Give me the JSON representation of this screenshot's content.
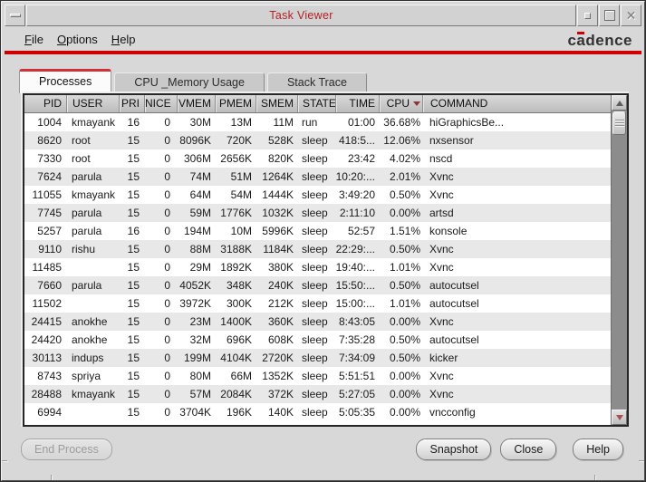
{
  "window": {
    "title": "Task Viewer"
  },
  "icons": {
    "window_menu": "dash",
    "minimize": "small-square",
    "maximize": "square-outline",
    "close": "x-cross",
    "sort_indicator": "triangle-down",
    "scroll_up": "triangle-up",
    "scroll_down": "triangle-down"
  },
  "menubar": {
    "items": [
      "File",
      "Options",
      "Help"
    ],
    "brand": "cadence"
  },
  "tabs": [
    {
      "label": "Processes",
      "active": true
    },
    {
      "label": "CPU _Memory Usage",
      "active": false
    },
    {
      "label": "Stack Trace",
      "active": false
    }
  ],
  "table": {
    "columns": [
      "PID",
      "USER",
      "PRI",
      "NICE",
      "VMEM",
      "PMEM",
      "SMEM",
      "STATE",
      "TIME",
      "CPU",
      "COMMAND"
    ],
    "sort": {
      "column": "CPU",
      "direction": "desc"
    },
    "rows": [
      [
        "1004",
        "kmayank",
        "16",
        "0",
        "30M",
        "13M",
        "11M",
        "run",
        "01:00",
        "36.68%",
        "hiGraphicsBe..."
      ],
      [
        "8620",
        "root",
        "15",
        "0",
        "8096K",
        "720K",
        "528K",
        "sleep",
        "418:5...",
        "12.06%",
        "nxsensor"
      ],
      [
        "7330",
        "root",
        "15",
        "0",
        "306M",
        "2656K",
        "820K",
        "sleep",
        "23:42",
        "4.02%",
        "nscd"
      ],
      [
        "7624",
        "parula",
        "15",
        "0",
        "74M",
        "51M",
        "1264K",
        "sleep",
        "10:20:...",
        "2.01%",
        "Xvnc"
      ],
      [
        "11055",
        "kmayank",
        "15",
        "0",
        "64M",
        "54M",
        "1444K",
        "sleep",
        "3:49:20",
        "0.50%",
        "Xvnc"
      ],
      [
        "7745",
        "parula",
        "15",
        "0",
        "59M",
        "1776K",
        "1032K",
        "sleep",
        "2:11:10",
        "0.00%",
        "artsd"
      ],
      [
        "5257",
        "parula",
        "16",
        "0",
        "194M",
        "10M",
        "5996K",
        "sleep",
        "52:57",
        "1.51%",
        "konsole"
      ],
      [
        "9110",
        "rishu",
        "15",
        "0",
        "88M",
        "3188K",
        "1184K",
        "sleep",
        "22:29:...",
        "0.50%",
        "Xvnc"
      ],
      [
        "11485",
        "",
        "15",
        "0",
        "29M",
        "1892K",
        "380K",
        "sleep",
        "19:40:...",
        "1.01%",
        "Xvnc"
      ],
      [
        "7660",
        "parula",
        "15",
        "0",
        "4052K",
        "348K",
        "240K",
        "sleep",
        "15:50:...",
        "0.50%",
        "autocutsel"
      ],
      [
        "11502",
        "",
        "15",
        "0",
        "3972K",
        "300K",
        "212K",
        "sleep",
        "15:00:...",
        "1.01%",
        "autocutsel"
      ],
      [
        "24415",
        "anokhe",
        "15",
        "0",
        "23M",
        "1400K",
        "360K",
        "sleep",
        "8:43:05",
        "0.00%",
        "Xvnc"
      ],
      [
        "24420",
        "anokhe",
        "15",
        "0",
        "32M",
        "696K",
        "608K",
        "sleep",
        "7:35:28",
        "0.50%",
        "autocutsel"
      ],
      [
        "30113",
        "indups",
        "15",
        "0",
        "199M",
        "4104K",
        "2720K",
        "sleep",
        "7:34:09",
        "0.50%",
        "kicker"
      ],
      [
        "8743",
        "spriya",
        "15",
        "0",
        "80M",
        "66M",
        "1352K",
        "sleep",
        "5:51:51",
        "0.00%",
        "Xvnc"
      ],
      [
        "28488",
        "kmayank",
        "15",
        "0",
        "57M",
        "2084K",
        "372K",
        "sleep",
        "5:27:05",
        "0.00%",
        "Xvnc"
      ],
      [
        "6994",
        "",
        "15",
        "0",
        "3704K",
        "196K",
        "140K",
        "sleep",
        "5:05:35",
        "0.00%",
        "vncconfig"
      ]
    ]
  },
  "buttons": {
    "end_process": {
      "label": "End Process",
      "enabled": false
    },
    "snapshot": {
      "label": "Snapshot"
    },
    "close": {
      "label": "Close"
    },
    "help": {
      "label": "Help"
    }
  },
  "colors": {
    "accent_red": "#cc0000",
    "title_red": "#b32025",
    "tab_active_edge": "#cf3137",
    "sort_arrow": "#8f3338",
    "scroll_down_arrow": "#a85050",
    "row_odd": "#ffffff",
    "row_even": "#e8e8e8",
    "chrome_gray": "#d8d8d8"
  }
}
